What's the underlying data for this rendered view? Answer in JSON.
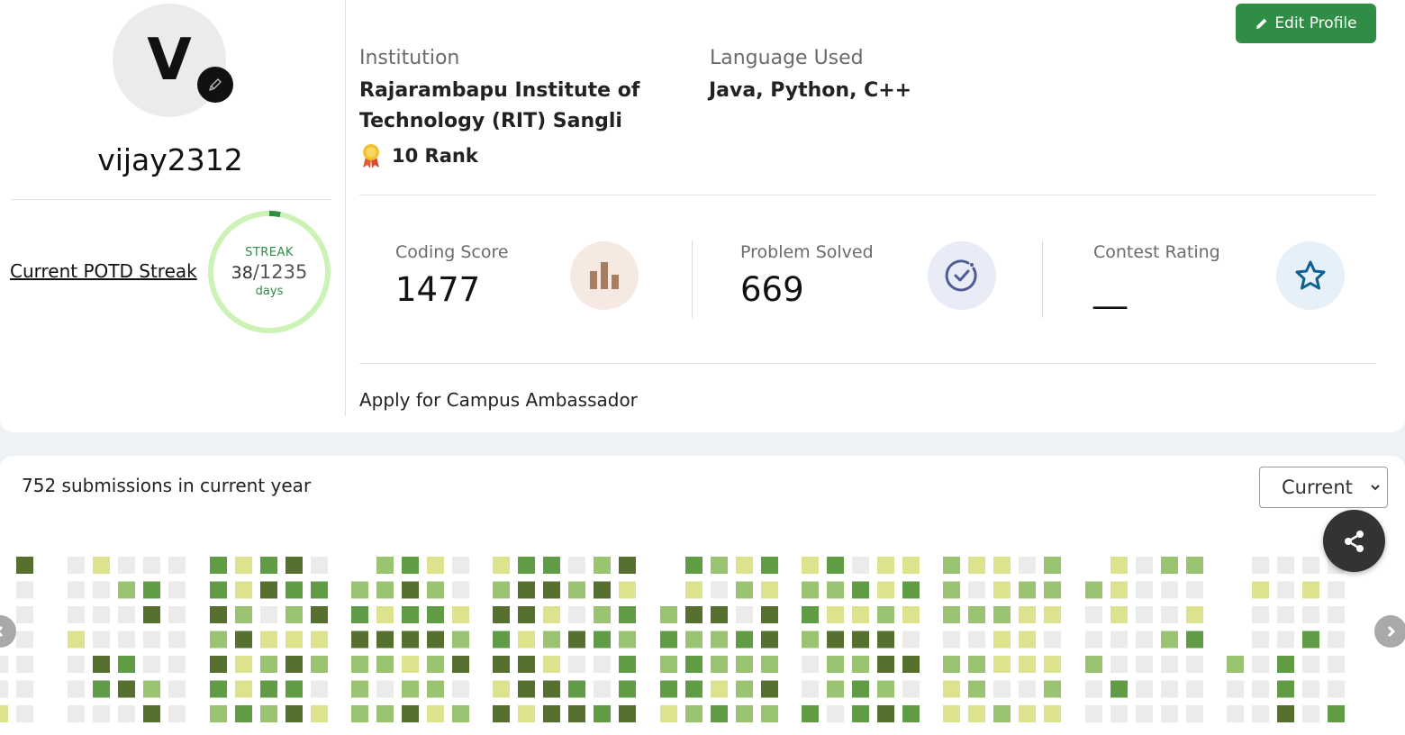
{
  "profile": {
    "avatar_initial": "V",
    "username": "vijay2312",
    "potd_link": "Current POTD Streak",
    "streak": {
      "label": "STREAK",
      "current": "38",
      "separator": "/",
      "longest": "1235",
      "unit": "days",
      "progress_fraction": 0.03
    }
  },
  "header": {
    "edit_profile_label": "Edit Profile"
  },
  "info": {
    "institution_label": "Institution",
    "institution_line1": "Rajarambapu Institute of",
    "institution_line2": "Technology (RIT) Sangli",
    "rank": "10 Rank",
    "language_label": "Language Used",
    "languages": "Java, Python, C++"
  },
  "stats": [
    {
      "label": "Coding Score",
      "value": "1477",
      "icon": "bar-chart-icon",
      "icon_bg": "#f6e9e1",
      "icon_color": "#a87e62"
    },
    {
      "label": "Problem Solved",
      "value": "669",
      "icon": "check-circle-icon",
      "icon_bg": "#e9ecf7",
      "icon_color": "#4f5b93"
    },
    {
      "label": "Contest Rating",
      "value": "__",
      "icon": "star-icon",
      "icon_bg": "#e5f0f8",
      "icon_color": "#0f5f93"
    }
  ],
  "ambassador_link": "Apply for Campus Ambassador",
  "submissions": {
    "summary": "752 submissions in current year",
    "year_selected": "Current"
  },
  "colors": {
    "accent": "#2f8d46",
    "level0": "#ebebeb",
    "level1": "#dde38c",
    "level2": "#9bc472",
    "level3": "#5f9c45",
    "level4": "#56712f"
  }
}
